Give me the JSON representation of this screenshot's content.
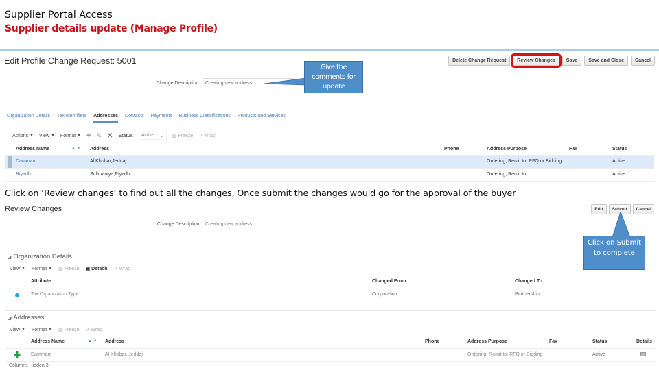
{
  "slide": {
    "title": "Supplier Portal Access",
    "subtitle": "Supplier details update (Manage Profile)",
    "instruction": "Click on ‘Review changes’ to find out all the changes, Once submit the changes would go for the approval of the buyer",
    "accent_color": "#c0141b",
    "callout_color": "#4f8ec9"
  },
  "edit_screen": {
    "page_title": "Edit Profile Change Request: 5001",
    "actions": [
      "Delete Change Request",
      "Review Changes",
      "Save",
      "Save and Close",
      "Cancel"
    ],
    "highlighted_action": "Review Changes",
    "change_description": {
      "label": "Change Description",
      "value": "Creating new address"
    },
    "callout": "Give the comments for update",
    "tabs": [
      "Organization Details",
      "Tax Identifiers",
      "Addresses",
      "Contacts",
      "Payments",
      "Business Classifications",
      "Products and Services"
    ],
    "active_tab": "Addresses",
    "toolbar": {
      "actions": "Actions",
      "view": "View",
      "format": "Format",
      "add_icon": "plus-icon",
      "edit_icon": "pencil-icon",
      "delete_icon": "x-icon",
      "status_label": "Status",
      "status_value": "Active",
      "freeze": "Freeze",
      "wrap": "Wrap"
    },
    "table": {
      "columns": [
        "Address Name",
        "Address",
        "Phone",
        "Address Purpose",
        "Fax",
        "Status"
      ],
      "rows": [
        {
          "name": "Dammam",
          "address": "Al Khobar,Jeddaj",
          "phone": "",
          "purpose": "Ordering; Remit to; RFQ or Bidding",
          "fax": "",
          "status": "Active"
        },
        {
          "name": "Riyadh",
          "address": "Sulimaniya,Riyadh",
          "phone": "",
          "purpose": "Ordering; Remit to",
          "fax": "",
          "status": "Active"
        }
      ]
    }
  },
  "review_screen": {
    "page_title": "Review Changes",
    "actions": [
      "Edit",
      "Submit",
      "Cancel"
    ],
    "change_description": {
      "label": "Change Description",
      "value": "Creating new address"
    },
    "callout": "Click on Submit to complete",
    "org_section": {
      "title": "Organization Details",
      "toolbar": {
        "view": "View",
        "format": "Format",
        "freeze": "Freeze",
        "detach": "Detach",
        "wrap": "Wrap"
      },
      "columns": [
        "Attribute",
        "Changed From",
        "Changed To"
      ],
      "rows": [
        {
          "attribute": "Tax Organization Type",
          "from": "Corporation",
          "to": "Partnership"
        }
      ]
    },
    "addr_section": {
      "title": "Addresses",
      "toolbar": {
        "view": "View",
        "format": "Format",
        "freeze": "Freeze",
        "wrap": "Wrap"
      },
      "columns": [
        "Address Name",
        "Address",
        "Phone",
        "Address Purpose",
        "Fax",
        "Status",
        "Details"
      ],
      "rows": [
        {
          "name": "Dammam",
          "address": "Al Khobar, Jeddaj",
          "phone": "",
          "purpose": "Ordering; Remit to; RFQ or Bidding",
          "fax": "",
          "status": "Active"
        }
      ],
      "columns_hidden": "Columns Hidden  3"
    }
  }
}
